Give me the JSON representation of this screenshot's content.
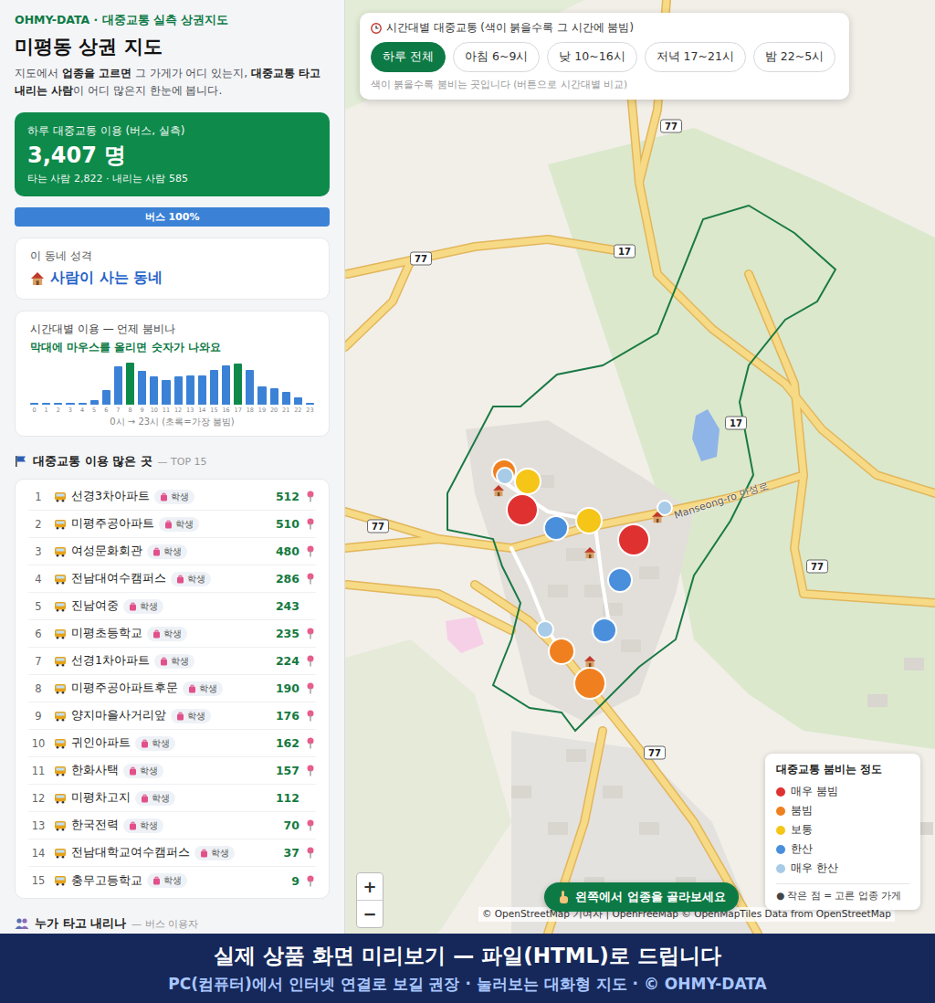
{
  "sidebar": {
    "brand": "OHMY-DATA · 대중교통 실측 상권지도",
    "title": "미평동 상권 지도",
    "description": [
      {
        "text": "지도에서 ",
        "bold": false
      },
      {
        "text": "업종을 고르면",
        "bold": true
      },
      {
        "text": " 그 가게가 어디 있는지, ",
        "bold": false
      },
      {
        "text": "대중교통 타고 내리는 사람",
        "bold": true
      },
      {
        "text": "이 어디 많은지 한눈에 봅니다.",
        "bold": false
      }
    ],
    "summary": {
      "label": "하루 대중교통 이용 (버스, 실측)",
      "value": "3,407 명",
      "detail": "타는 사람 2,822 · 내리는 사람 585"
    },
    "mode_bar": {
      "label": "버스 100%",
      "level": 1
    },
    "character": {
      "label": "이 동네 성격",
      "value": "사람이 사는 동네"
    },
    "hourly_chart": {
      "title": "시간대별 이용 — 언제 붐비나",
      "hint": "막대에 마우스를 올리면 숫자가 나와요",
      "hours": [
        "0",
        "1",
        "2",
        "3",
        "4",
        "5",
        "6",
        "7",
        "8",
        "9",
        "10",
        "11",
        "12",
        "13",
        "14",
        "15",
        "16",
        "17",
        "18",
        "19",
        "20",
        "21",
        "22",
        "23"
      ],
      "values": [
        4,
        3,
        3,
        3,
        4,
        35,
        105,
        270,
        290,
        235,
        195,
        170,
        195,
        205,
        205,
        245,
        275,
        285,
        240,
        130,
        115,
        90,
        55,
        8
      ],
      "peak": [
        false,
        false,
        false,
        false,
        false,
        false,
        false,
        false,
        true,
        false,
        false,
        false,
        false,
        false,
        false,
        false,
        false,
        true,
        false,
        false,
        false,
        false,
        false,
        false
      ],
      "caption": "0시 → 23시 (초록=가장 붐빔)"
    },
    "top_list": {
      "title": "대중교통 이용 많은 곳",
      "subtitle": "— TOP 15",
      "rows": [
        {
          "rank": "1",
          "name": "선경3차아파트",
          "tag": "학생",
          "count": "512",
          "pinned": true
        },
        {
          "rank": "2",
          "name": "미평주공아파트",
          "tag": "학생",
          "count": "510",
          "pinned": true
        },
        {
          "rank": "3",
          "name": "여성문화회관",
          "tag": "학생",
          "count": "480",
          "pinned": true
        },
        {
          "rank": "4",
          "name": "전남대여수캠퍼스",
          "tag": "학생",
          "count": "286",
          "pinned": true
        },
        {
          "rank": "5",
          "name": "진남여중",
          "tag": "학생",
          "count": "243",
          "pinned": false
        },
        {
          "rank": "6",
          "name": "미평초등학교",
          "tag": "학생",
          "count": "235",
          "pinned": true
        },
        {
          "rank": "7",
          "name": "선경1차아파트",
          "tag": "학생",
          "count": "224",
          "pinned": true
        },
        {
          "rank": "8",
          "name": "미평주공아파트후문",
          "tag": "학생",
          "count": "190",
          "pinned": true
        },
        {
          "rank": "9",
          "name": "양지마을사거리앞",
          "tag": "학생",
          "count": "176",
          "pinned": true
        },
        {
          "rank": "10",
          "name": "귀인아파트",
          "tag": "학생",
          "count": "162",
          "pinned": true
        },
        {
          "rank": "11",
          "name": "한화사택",
          "tag": "학생",
          "count": "157",
          "pinned": true
        },
        {
          "rank": "12",
          "name": "미평차고지",
          "tag": "학생",
          "count": "112",
          "pinned": false
        },
        {
          "rank": "13",
          "name": "한국전력",
          "tag": "학생",
          "count": "70",
          "pinned": true
        },
        {
          "rank": "14",
          "name": "전남대학교여수캠퍼스",
          "tag": "학생",
          "count": "37",
          "pinned": true
        },
        {
          "rank": "15",
          "name": "충무고등학교",
          "tag": "학생",
          "count": "9",
          "pinned": true
        }
      ]
    },
    "next_section": {
      "title": "누가 타고 내리나",
      "subtitle": "— 버스 이용자"
    }
  },
  "map": {
    "toolbar": {
      "title": "시간대별 대중교통 (색이 붉을수록 그 시간에 붐빔)",
      "buttons": [
        {
          "label": "하루 전체",
          "selected": true
        },
        {
          "label": "아침 6~9시",
          "selected": false
        },
        {
          "label": "낮 10~16시",
          "selected": false
        },
        {
          "label": "저녁 17~21시",
          "selected": false
        },
        {
          "label": "밤 22~5시",
          "selected": false
        }
      ],
      "hint": "색이 붉을수록 붐비는 곳입니다 (버튼으로 시간대별 비교)"
    },
    "road_labels": [
      {
        "text": "77",
        "kind": "shield"
      },
      {
        "text": "77",
        "kind": "shield"
      },
      {
        "text": "17",
        "kind": "shield"
      },
      {
        "text": "77",
        "kind": "shield"
      },
      {
        "text": "17",
        "kind": "shield"
      },
      {
        "text": "77",
        "kind": "shield"
      },
      {
        "text": "77",
        "kind": "shield"
      },
      {
        "text": "Manseong-ro 만성로",
        "kind": "name"
      }
    ],
    "stops": [
      {
        "color": "#f0801f",
        "level": 0.5
      },
      {
        "color": "#a8cbe8",
        "level": 0.1
      },
      {
        "color": "#f5c518",
        "level": 0.6
      },
      {
        "color": "#e03131",
        "level": 0.9
      },
      {
        "color": "#4a8fdc",
        "level": 0.5
      },
      {
        "color": "#f5c518",
        "level": 0.6
      },
      {
        "color": "#e03131",
        "level": 0.9
      },
      {
        "color": "#a8cbe8",
        "level": 0.0
      },
      {
        "color": "#4a8fdc",
        "level": 0.5
      },
      {
        "color": "#4a8fdc",
        "level": 0.5
      },
      {
        "color": "#a8cbe8",
        "level": 0.1
      },
      {
        "color": "#f0801f",
        "level": 0.6
      },
      {
        "color": "#f0801f",
        "level": 0.9
      }
    ],
    "legend": {
      "title": "대중교통 붐비는 정도",
      "items": [
        {
          "label": "매우 붐빔",
          "color": "#e03131"
        },
        {
          "label": "붐빔",
          "color": "#f0801f"
        },
        {
          "label": "보통",
          "color": "#f5c518"
        },
        {
          "label": "한산",
          "color": "#4a8fdc"
        },
        {
          "label": "매우 한산",
          "color": "#a8cbe8"
        }
      ],
      "footnote": "● 작은 점 = 고른 업종 가게"
    },
    "zoom": {
      "in": "+",
      "out": "−"
    },
    "prompt": "왼쪽에서 업종을 골라보세요",
    "attribution": "© OpenStreetMap 기여자 | OpenFreeMap © OpenMapTiles Data from OpenStreetMap"
  },
  "banner": {
    "title": "실제 상품 화면 미리보기 — 파일(HTML)로 드립니다",
    "subtitle": "PC(컴퓨터)에서 인터넷 연결로 보길 권장 · 눌러보는 대화형 지도 · © OHMY-DATA"
  }
}
